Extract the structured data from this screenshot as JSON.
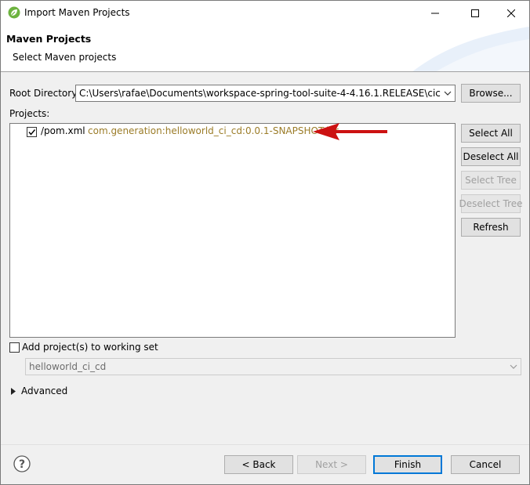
{
  "window": {
    "title": "Import Maven Projects"
  },
  "banner": {
    "title": "Maven Projects",
    "subtitle": "Select Maven projects"
  },
  "root": {
    "label": "Root Directory:",
    "value": "C:\\Users\\rafae\\Documents\\workspace-spring-tool-suite-4-4.16.1.RELEASE\\cicd_hellowo",
    "browse_label": "Browse..."
  },
  "projects": {
    "label": "Projects:",
    "items": [
      {
        "name": "/pom.xml",
        "coordinates": "com.generation:helloworld_ci_cd:0.0.1-SNAPSHOT:jar",
        "checked": true
      }
    ]
  },
  "side_buttons": {
    "select_all": "Select All",
    "deselect_all": "Deselect All",
    "select_tree": "Select Tree",
    "deselect_tree": "Deselect Tree",
    "refresh": "Refresh"
  },
  "working_set": {
    "label": "Add project(s) to working set",
    "checked": false,
    "value": "helloworld_ci_cd"
  },
  "advanced": {
    "label": "Advanced"
  },
  "footer": {
    "back": "< Back",
    "next": "Next >",
    "finish": "Finish",
    "cancel": "Cancel"
  },
  "colors": {
    "arrow": "#cc1111",
    "coordinates": "#9b7c28",
    "default_button_border": "#0078d7"
  },
  "icons": {
    "app": "spring-leaf-icon",
    "help": "question-mark-icon"
  }
}
